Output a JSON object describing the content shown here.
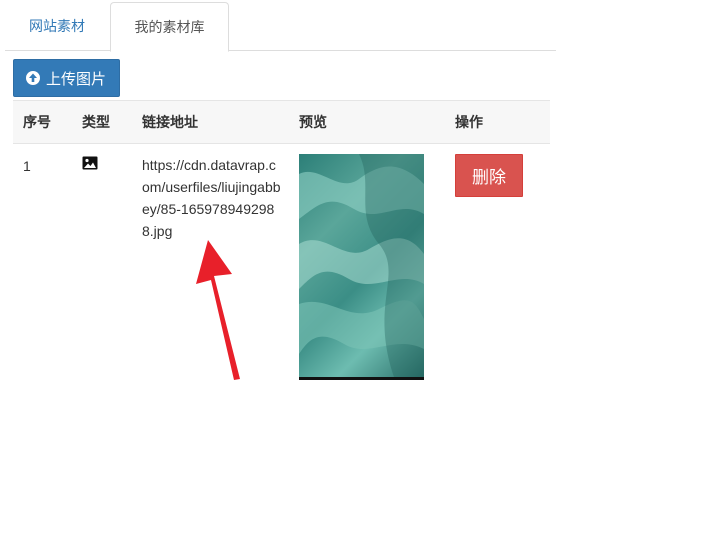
{
  "tabs": [
    {
      "label": "网站素材",
      "active": false
    },
    {
      "label": "我的素材库",
      "active": true
    }
  ],
  "toolbar": {
    "upload_label": "上传图片",
    "upload_icon": "arrow-up-circle-icon"
  },
  "table": {
    "headers": {
      "index": "序号",
      "type": "类型",
      "link": "链接地址",
      "preview": "预览",
      "ops": "操作"
    },
    "rows": [
      {
        "index": "1",
        "type_icon": "image-icon",
        "link": "https://cdn.datavrap.com/userfiles/liujingabbey/85-1659789492988.jpg",
        "delete_label": "删除"
      }
    ]
  },
  "colors": {
    "primary": "#337ab7",
    "danger": "#d9534f",
    "annotation": "#e8202a"
  }
}
